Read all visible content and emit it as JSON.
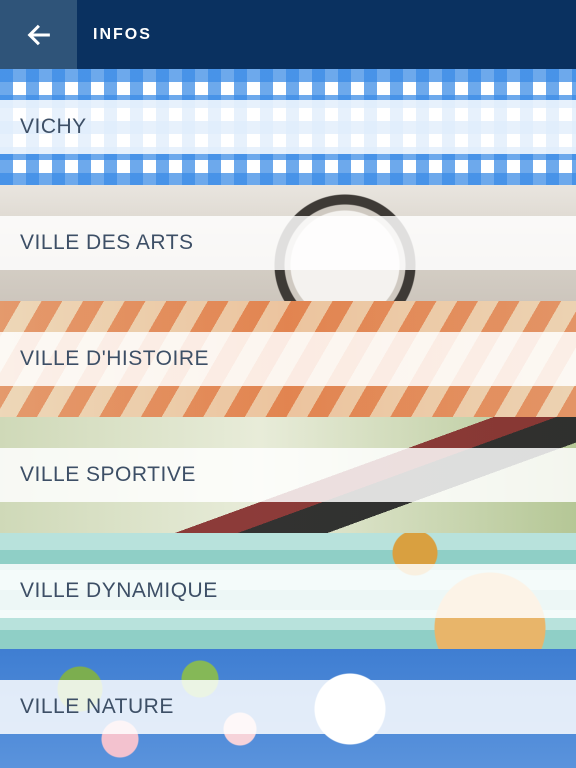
{
  "header": {
    "title": "INFOS",
    "back_icon": "arrow-left-icon",
    "background": "#0a3160",
    "back_button_background": "#2f5479"
  },
  "menu": {
    "items": [
      {
        "label": "VICHY",
        "background": "gingham-pattern"
      },
      {
        "label": "VILLE DES ARTS",
        "background": "clock-sculpture-photo"
      },
      {
        "label": "VILLE D'HISTOIRE",
        "background": "old-map-photo"
      },
      {
        "label": "VILLE SPORTIVE",
        "background": "running-shoe-photo"
      },
      {
        "label": "VILLE DYNAMIQUE",
        "background": "spa-products-photo"
      },
      {
        "label": "VILLE NATURE",
        "background": "blossom-photo"
      }
    ]
  },
  "colors": {
    "label_text": "#3d4f66",
    "band_overlay": "rgba(255,255,255,0.84)"
  }
}
